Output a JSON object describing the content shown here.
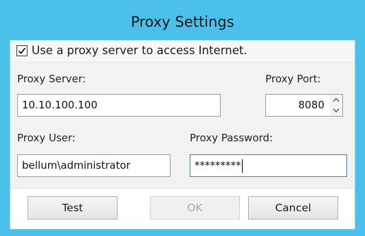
{
  "window": {
    "title": "Proxy Settings"
  },
  "proxy_toggle": {
    "label": "Use a proxy server to access Internet.",
    "checked": true
  },
  "fields": {
    "server_label": "Proxy Server:",
    "server_value": "10.10.100.100",
    "port_label": "Proxy Port:",
    "port_value": "8080",
    "user_label": "Proxy User:",
    "user_value": "bellum\\administrator",
    "password_label": "Proxy Password:",
    "password_value": "*********"
  },
  "buttons": {
    "test": "Test",
    "ok": "OK",
    "ok_enabled": false,
    "cancel": "Cancel"
  },
  "icons": {
    "checkbox": "checkmark-icon",
    "spinner_up": "chevron-up-icon",
    "spinner_down": "chevron-down-icon"
  },
  "colors": {
    "title_bar": "#4bc0ea"
  }
}
